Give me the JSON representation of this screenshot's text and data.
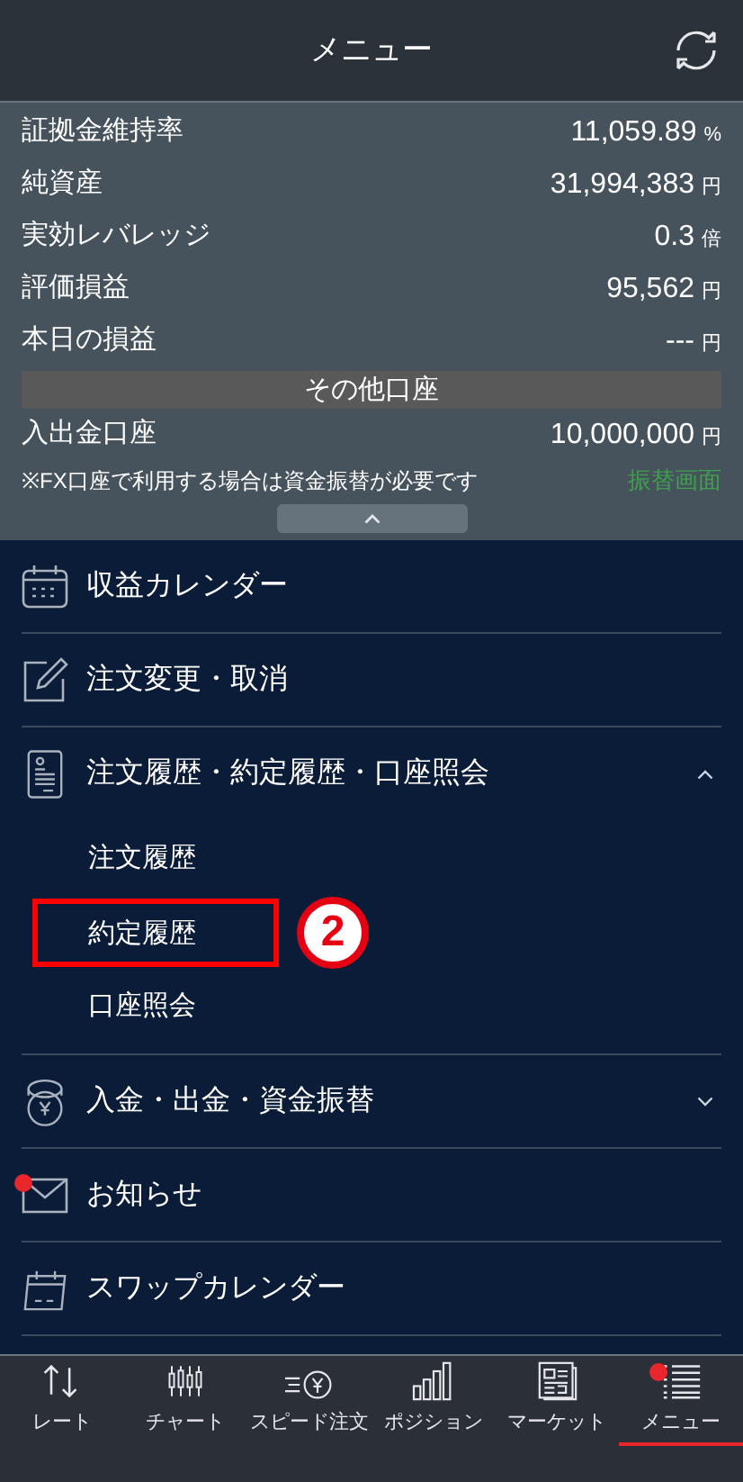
{
  "header": {
    "title": "メニュー"
  },
  "account": {
    "rows": [
      {
        "label": "証拠金維持率",
        "value": "11,059.89",
        "unit": "%"
      },
      {
        "label": "純資産",
        "value": "31,994,383",
        "unit": "円"
      },
      {
        "label": "実効レバレッジ",
        "value": "0.3",
        "unit": "倍"
      },
      {
        "label": "評価損益",
        "value": "95,562",
        "unit": "円"
      },
      {
        "label": "本日の損益",
        "value": "---",
        "unit": "円"
      }
    ],
    "section_title": "その他口座",
    "other_rows": [
      {
        "label": "入出金口座",
        "value": "10,000,000",
        "unit": "円"
      }
    ],
    "note": "※FX口座で利用する場合は資金振替が必要です",
    "transfer_link": "振替画面"
  },
  "menu": [
    {
      "kind": "link",
      "label": "収益カレンダー",
      "notification_dot": false
    },
    {
      "kind": "link",
      "label": "注文変更・取消",
      "notification_dot": false
    },
    {
      "kind": "group",
      "label": "注文履歴・約定履歴・口座照会",
      "notification_dot": false,
      "expanded": true,
      "children": [
        {
          "label": "注文履歴",
          "highlighted": false
        },
        {
          "label": "約定履歴",
          "highlighted": true,
          "annotation": "2"
        },
        {
          "label": "口座照会",
          "highlighted": false
        }
      ]
    },
    {
      "kind": "group",
      "label": "入金・出金・資金振替",
      "notification_dot": false,
      "expanded": false
    },
    {
      "kind": "link",
      "label": "お知らせ",
      "notification_dot": true
    },
    {
      "kind": "link",
      "label": "スワップカレンダー",
      "notification_dot": false
    }
  ],
  "tabs": [
    {
      "label": "レート",
      "selected": false,
      "notification_dot": false
    },
    {
      "label": "チャート",
      "selected": false,
      "notification_dot": false
    },
    {
      "label": "スピード注文",
      "selected": false,
      "notification_dot": false
    },
    {
      "label": "ポジション",
      "selected": false,
      "notification_dot": false
    },
    {
      "label": "マーケット",
      "selected": false,
      "notification_dot": false
    },
    {
      "label": "メニュー",
      "selected": true,
      "notification_dot": true
    }
  ]
}
